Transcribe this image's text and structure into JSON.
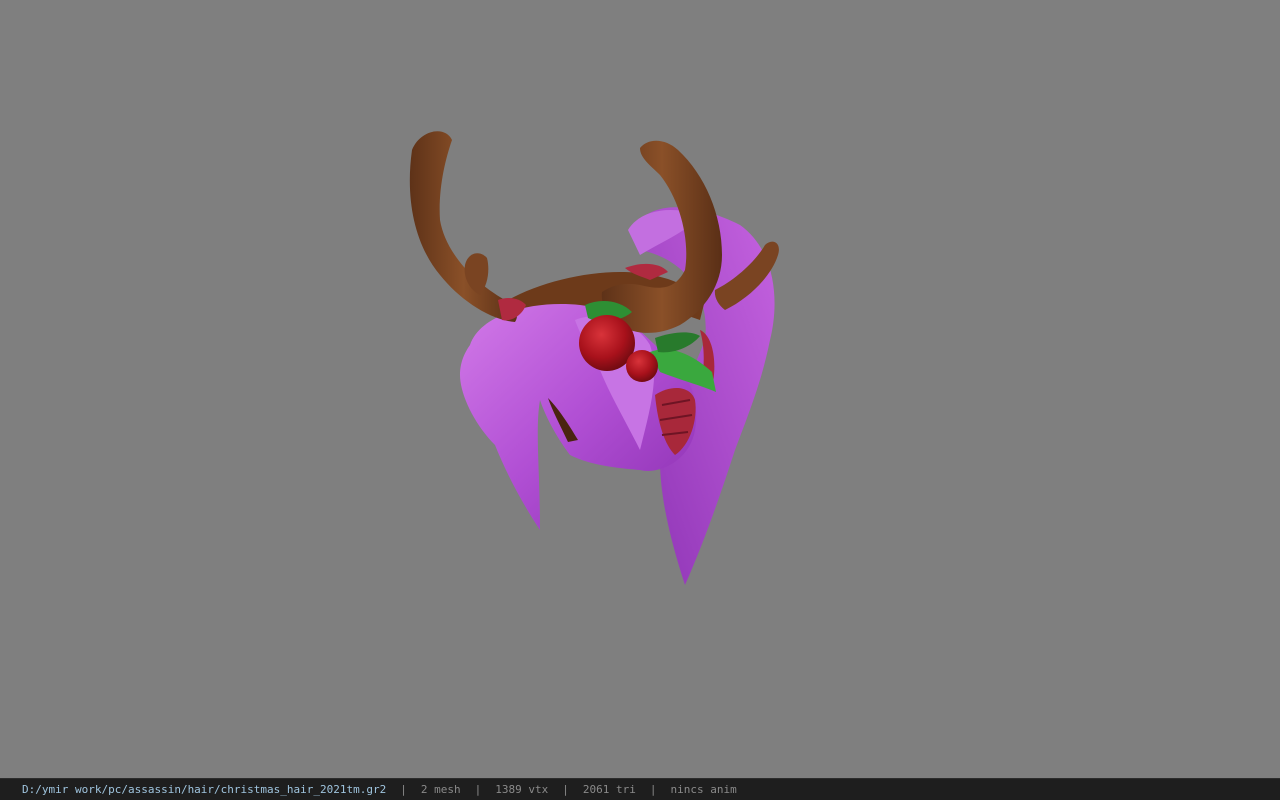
{
  "model": {
    "icon": "reindeer-antler-hair-model",
    "colors": {
      "background": "#7f7f7f",
      "hair": "#b552d6",
      "antler": "#7a4422",
      "berry": "#b0121b",
      "leaf": "#2e8f34",
      "ribbon": "#a8283a"
    }
  },
  "status_bar": {
    "file_path": "D:/ymir work/pc/assassin/hair/christmas_hair_2021tm.gr2",
    "separator": "|",
    "mesh": "2 mesh",
    "vertices": "1389 vtx",
    "triangles": "2061 tri",
    "animation": "nincs anim"
  }
}
